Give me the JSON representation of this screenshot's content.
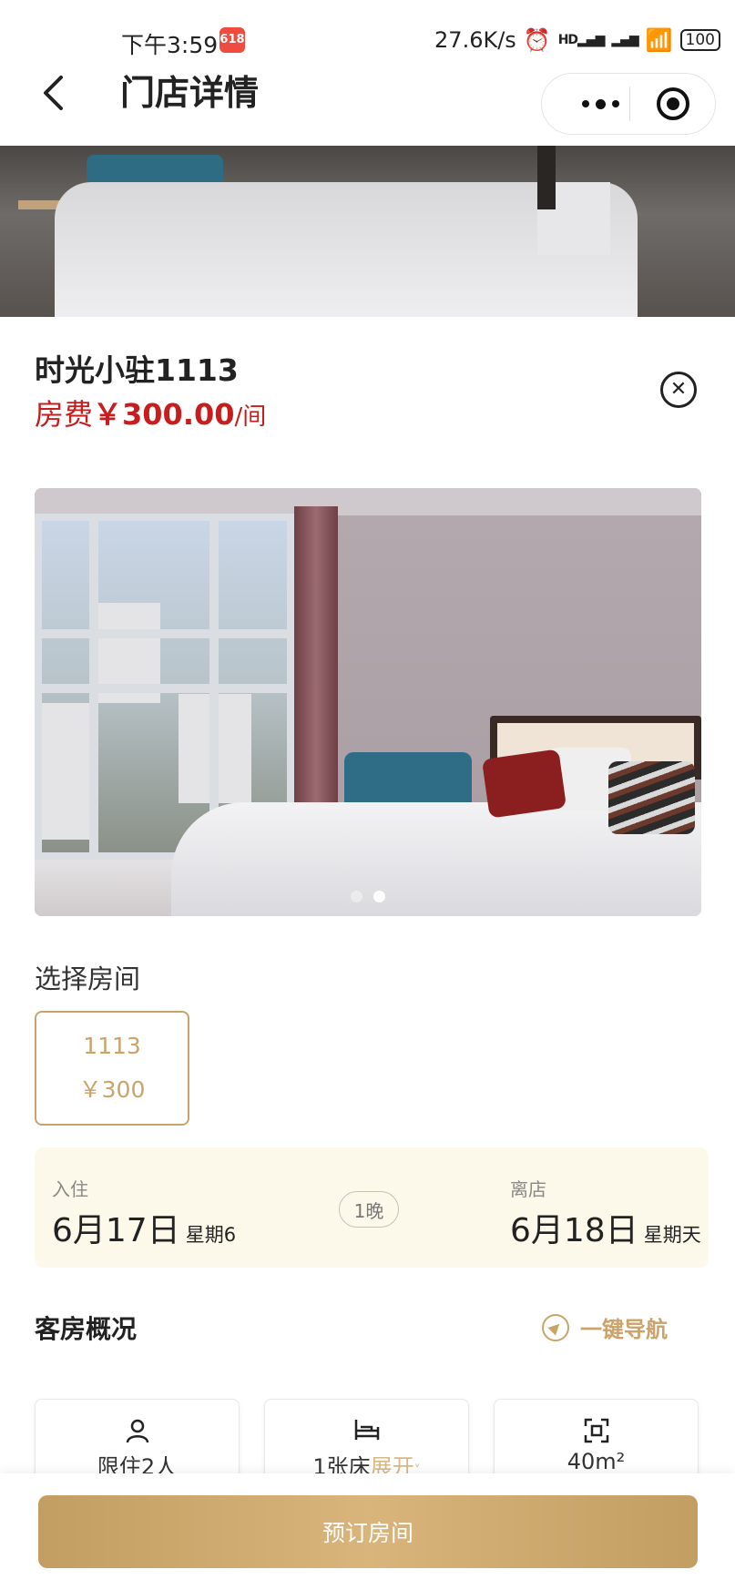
{
  "status_bar": {
    "time": "下午3:59",
    "net_speed": "27.6K/s",
    "signal_label": "HD",
    "battery": "100"
  },
  "header": {
    "title": "门店详情"
  },
  "room": {
    "name": "时光小驻1113",
    "price_label": "房费",
    "price_amount": "￥300.00",
    "price_unit": "/间"
  },
  "gallery": {
    "slide_count": 2,
    "active_slide": 2
  },
  "select_room": {
    "label": "选择房间",
    "options": [
      {
        "number": "1113",
        "price": "￥300"
      }
    ]
  },
  "stay": {
    "checkin_label": "入住",
    "checkin_date": "6月17日",
    "checkin_weekday": "星期6",
    "nights": "1晚",
    "checkout_label": "离店",
    "checkout_date": "6月18日",
    "checkout_weekday": "星期天"
  },
  "overview": {
    "title": "客房概况",
    "nav_link": "一键导航",
    "cards": [
      {
        "icon": "person-icon",
        "text": "限住2人"
      },
      {
        "icon": "bed-icon",
        "text": "1张床",
        "expand": "展开"
      },
      {
        "icon": "area-icon",
        "text": "40m²"
      }
    ]
  },
  "footer": {
    "book_button": "预订房间"
  },
  "colors": {
    "accent_gold": "#c9a36a",
    "price_red": "#c71d1d",
    "date_panel_bg": "#fdf9ea"
  }
}
